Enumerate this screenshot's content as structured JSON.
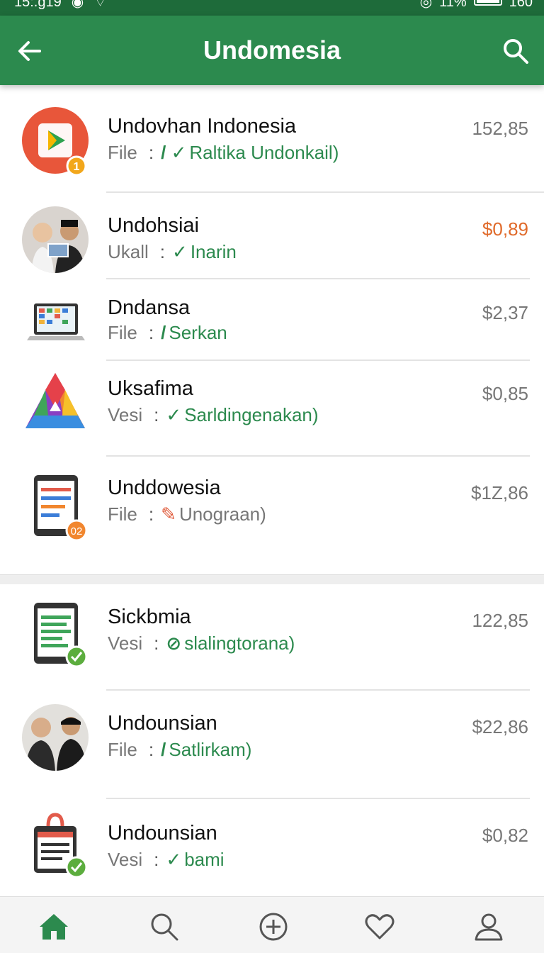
{
  "status": {
    "time": "15:.g19",
    "battery": "11%",
    "signal": "160"
  },
  "header": {
    "title": "Undomesia"
  },
  "items": [
    {
      "name": "Undovhan Indonesia",
      "type": "File",
      "tag": "Raltika Undonkail)",
      "price": "152,85",
      "icon": "play-store-icon"
    },
    {
      "name": "Undohsiai",
      "type": "Ukall",
      "tag": "Inarin",
      "price": "$0,89",
      "icon": "people-avatar"
    },
    {
      "name": "Dndansa",
      "type": "File",
      "tag": "Serkan",
      "price": "$2,37",
      "icon": "laptop-icon"
    },
    {
      "name": "Uksafima",
      "type": "Vesi",
      "tag": "Sarldingenakan)",
      "price": "$0,85",
      "icon": "drive-icon"
    },
    {
      "name": "Unddowesia",
      "type": "File",
      "tag": "Unograan)",
      "price": "$1Z,86",
      "icon": "tablet-icon"
    },
    {
      "name": "Sickbmia",
      "type": "Vesi",
      "tag": "slalingtorana)",
      "price": "122,85",
      "icon": "tablet-green-icon"
    },
    {
      "name": "Undounsian",
      "type": "File",
      "tag": "Satlirkam)",
      "price": "$22,86",
      "icon": "people-avatar-2"
    },
    {
      "name": "Undounsian",
      "type": "Vesi",
      "tag": "bami",
      "price": "$0,82",
      "icon": "clipboard-icon"
    }
  ],
  "badges": {
    "first": "1",
    "fifth": "02"
  },
  "colors": {
    "primary": "#2c8a4e",
    "statusbar": "#1e6b3a",
    "price_highlight": "#e06a2a"
  }
}
